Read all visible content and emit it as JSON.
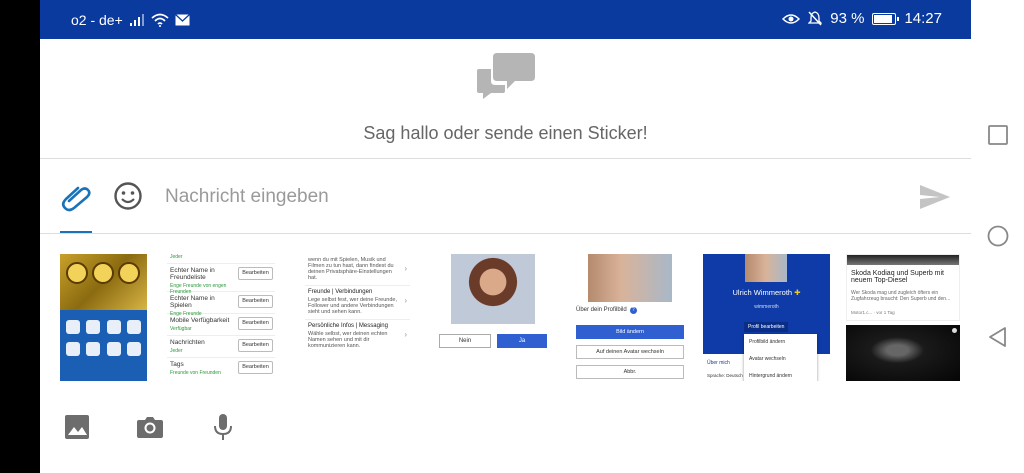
{
  "status_bar": {
    "carrier": "o2 - de+",
    "battery_percent": "93 %",
    "battery_level": 0.93,
    "time": "14:27"
  },
  "chat": {
    "empty_prompt": "Sag hallo oder sende einen Sticker!"
  },
  "composer": {
    "placeholder": "Nachricht eingeben"
  },
  "gallery": {
    "t2_rows": [
      {
        "label": "Jeder",
        "sub": "",
        "button": "Bearbeiten"
      },
      {
        "label": "Echter Name in Freundeliste",
        "sub": "Enge Freunde von engen Freunden",
        "button": "Bearbeiten"
      },
      {
        "label": "Echter Name in Spielen",
        "sub": "Enge Freunde",
        "button": "Bearbeiten"
      },
      {
        "label": "Mobile Verfügbarkeit",
        "sub": "Verfügbar",
        "button": "Bearbeiten"
      },
      {
        "label": "Nachrichten",
        "sub": "Jeder",
        "button": "Bearbeiten"
      },
      {
        "label": "Tags",
        "sub": "Freunde von Freunden",
        "button": "Bearbeiten"
      }
    ],
    "t3_blocks": [
      {
        "title": "",
        "text": "wenn du mit Spielen, Musik und Filmen zu tun hast, dann findest du deinen Privatsphäre-Einstellungen hat."
      },
      {
        "title": "Freunde | Verbindungen",
        "text": "Lege selbst fest, wer deine Freunde, Follower und andere Verbindungen sieht und sehen kann."
      },
      {
        "title": "Persönliche Infos | Messaging",
        "text": "Wähle selbst, wer deinen echten Namen sehen und mit dir kommunizieren kann."
      }
    ],
    "t4": {
      "no": "Nein",
      "yes": "Ja"
    },
    "t5": {
      "caption": "Über dein Profilbild",
      "change": "Bild ändern",
      "avatar": "Auf deinen Avatar wechseln",
      "cancel": "Abbr."
    },
    "t6": {
      "name": "Ulrich Wimmeroth",
      "handle": "wimmeroth",
      "edit": "Profil bearbeiten",
      "menu": [
        "Profilbild ändern",
        "Avatar wechseln",
        "Hintergrund ändern"
      ],
      "about": "Über mich",
      "lang": "Sprache: Deutsch"
    },
    "t7": {
      "title": "Skoda Kodiaq und Superb mit neuem Top-Diesel",
      "desc": "Wer Skoda mag und zugleich öfters ein Zugfahrzeug braucht: Den Superb und den...",
      "meta": "Motor1.c... · vor 1 Tag"
    }
  },
  "icons": {
    "attach": "paperclip-icon",
    "emoji": "emoji-icon",
    "send": "send-icon",
    "gallery": "image-icon",
    "camera": "camera-icon",
    "mic": "microphone-icon"
  },
  "colors": {
    "status_bar": "#0a3a9e",
    "accent": "#1a73b8",
    "button_blue": "#2f5fd0"
  }
}
